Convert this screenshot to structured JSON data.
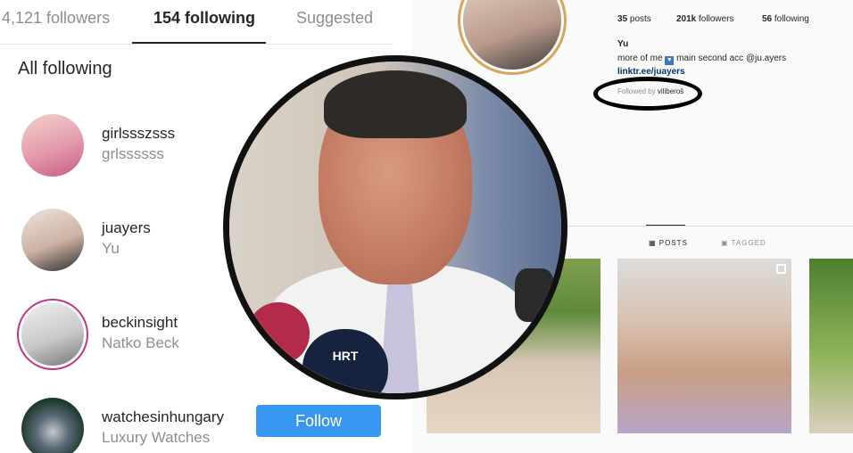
{
  "following_list": {
    "tabs": [
      {
        "label": "4,121 followers"
      },
      {
        "label": "154 following"
      },
      {
        "label": "Suggested"
      }
    ],
    "section_title": "All following",
    "users": [
      {
        "username": "girlssszsss",
        "full_name": "grlssssss",
        "avatar_color": "#e8a4b0"
      },
      {
        "username": "juayers",
        "full_name": "Yu",
        "avatar_color": "#d9c2b4"
      },
      {
        "username": "beckinsight",
        "full_name": "Natko Beck",
        "avatar_color": "#cfcfcf"
      },
      {
        "username": "watchesinhungary",
        "full_name": "Luxury Watches",
        "avatar_color": "#6a7a88",
        "button": "Follow"
      }
    ]
  },
  "profile": {
    "stats": {
      "posts_count": "35",
      "posts_label": "posts",
      "followers_count": "201k",
      "followers_label": "followers",
      "following_count": "56",
      "following_label": "following"
    },
    "name": "Yu",
    "bio_before": "more of me",
    "bio_after": "main second acc @ju.ayers",
    "link": "linktr.ee/juayers",
    "followed_by_prefix": "Followed by",
    "followed_by_user": "viliberoš",
    "grid_tabs": {
      "posts": "POSTS",
      "tagged": "TAGGED"
    }
  },
  "overlay_photo": {
    "mic_label": "HRT"
  },
  "colors": {
    "follow_button": "#3897f0",
    "highlight_ring": "#000000",
    "story_ring": "#c13584"
  }
}
